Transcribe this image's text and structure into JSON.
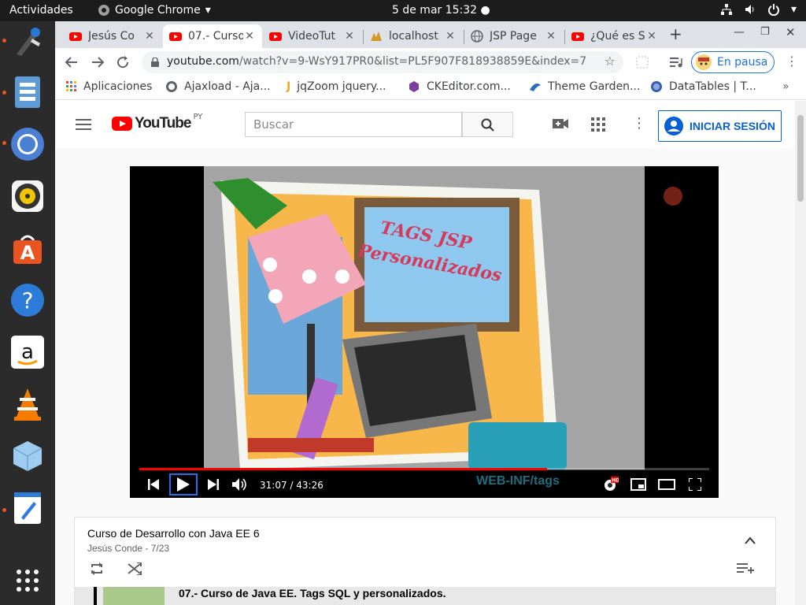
{
  "topbar": {
    "activities": "Actividades",
    "app_name": "Google Chrome",
    "clock": "5 de mar  15:32"
  },
  "dock": {
    "items": [
      "firefox-icon",
      "files-icon",
      "chrome-icon",
      "rhythmbox-icon",
      "software-icon",
      "help-icon",
      "amazon-icon",
      "vlc-icon",
      "virtualbox-icon",
      "text-editor-icon",
      "show-apps-icon"
    ]
  },
  "tabs": [
    {
      "title": "Jesús Co",
      "favicon": "youtube"
    },
    {
      "title": "07.- Curso",
      "favicon": "youtube"
    },
    {
      "title": "VideoTut",
      "favicon": "youtube"
    },
    {
      "title": "localhost",
      "favicon": "tomcat"
    },
    {
      "title": "JSP Page",
      "favicon": "globe"
    },
    {
      "title": "¿Qué es S",
      "favicon": "youtube"
    }
  ],
  "omnibox": {
    "url_host": "youtube.com",
    "url_path": "/watch?v=9-WsY917PR0&list=PL5F907F818938859E&index=7"
  },
  "profile": {
    "label": "En pausa"
  },
  "bookmarks": [
    {
      "label": "Aplicaciones"
    },
    {
      "label": "Ajaxload - Aja..."
    },
    {
      "label": "jqZoom jquery..."
    },
    {
      "label": "CKEditor.com..."
    },
    {
      "label": "Theme Garden..."
    },
    {
      "label": "DataTables | T..."
    }
  ],
  "youtube": {
    "logo": "YouTube",
    "region": "PY",
    "search_placeholder": "Buscar",
    "signin": "INICIAR SESIÓN"
  },
  "video": {
    "time": "31:07 / 43:26",
    "progress_fraction": 0.716,
    "thumb_title_line1": "TAGS JSP",
    "thumb_title_line2": "Personalizados",
    "thumb_case_text": "WEB-INF/tags",
    "quality_badge": "HD"
  },
  "playlist": {
    "title": "Curso de Desarrollo con Java EE 6",
    "subtitle": "Jesús Conde - 7/23",
    "current_item": "07.- Curso de Java EE. Tags SQL y personalizados."
  },
  "colors": {
    "youtube_red": "#ff0000",
    "link_blue": "#065fd4",
    "ubuntu_orange": "#e95420"
  }
}
